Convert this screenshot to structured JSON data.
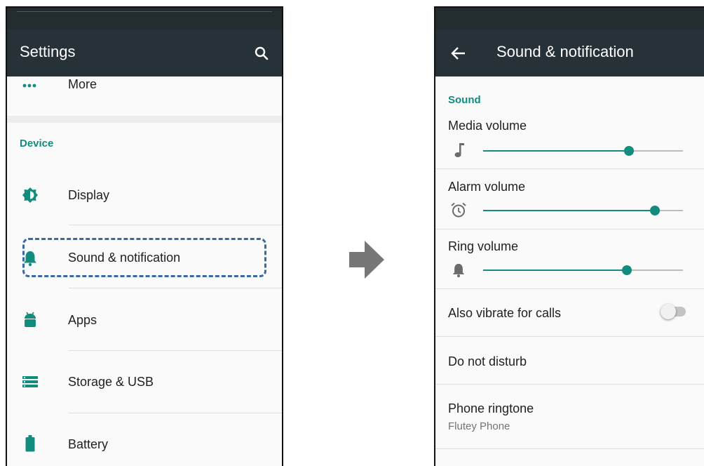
{
  "left_screen": {
    "app_title": "Settings",
    "more_label": "More",
    "section_device": "Device",
    "items": [
      {
        "label": "Display",
        "icon": "brightness-icon"
      },
      {
        "label": "Sound & notification",
        "icon": "bell-icon"
      },
      {
        "label": "Apps",
        "icon": "android-icon"
      },
      {
        "label": "Storage & USB",
        "icon": "storage-icon"
      },
      {
        "label": "Battery",
        "icon": "battery-icon"
      }
    ]
  },
  "right_screen": {
    "app_title": "Sound & notification",
    "section_sound": "Sound",
    "volumes": [
      {
        "label": "Media volume",
        "icon": "music-note-icon",
        "level": 0.73
      },
      {
        "label": "Alarm volume",
        "icon": "alarm-clock-icon",
        "level": 0.86
      },
      {
        "label": "Ring volume",
        "icon": "bell-icon",
        "level": 0.72
      }
    ],
    "vibrate": {
      "label": "Also vibrate for calls",
      "on": false
    },
    "dnd_label": "Do not disturb",
    "ringtone": {
      "label": "Phone ringtone",
      "value": "Flutey Phone"
    }
  },
  "colors": {
    "accent": "#128c7e",
    "app_bar": "#263238",
    "status_bar": "#232d30",
    "highlight_border": "#3a6aa2",
    "transition_arrow": "#777777"
  }
}
